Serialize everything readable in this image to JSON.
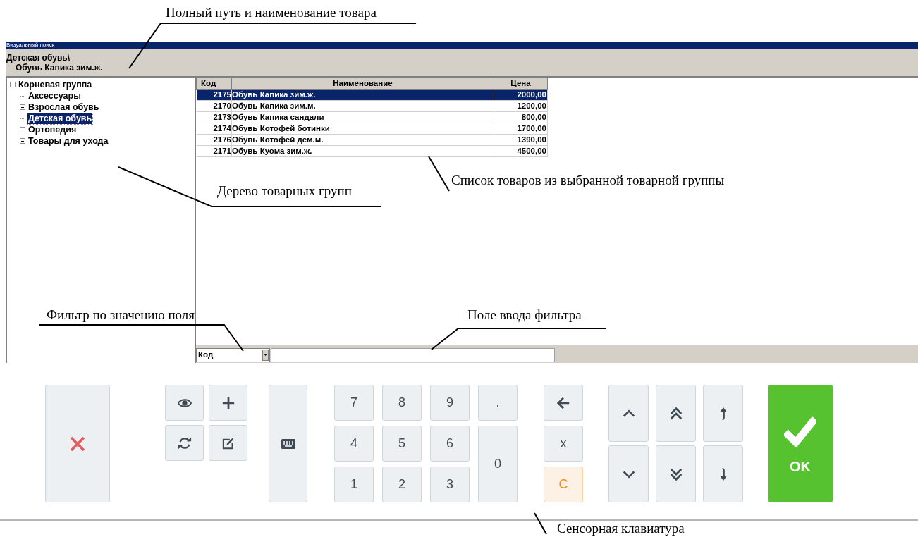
{
  "annotations": [
    {
      "text": "Полный путь и наименование товара"
    },
    {
      "text": "Дерево товарных групп"
    },
    {
      "text": "Список товаров из выбранной товарной группы"
    },
    {
      "text": "Фильтр по значению поля"
    },
    {
      "text": "Поле ввода фильтра"
    },
    {
      "text": "Сенсорная клавиатура"
    }
  ],
  "window": {
    "title": "Визуальный поиск"
  },
  "path": {
    "lines": [
      "Детская обувь\\",
      "Обувь Капика зим.ж."
    ]
  },
  "tree": [
    {
      "kind": "group",
      "label": "Корневая группа",
      "selected": false,
      "expanded": true,
      "children": [
        {
          "kind": "leaf",
          "label": "Аксессуары",
          "selected": false,
          "expanded": false
        },
        {
          "kind": "group",
          "label": "Взрослая обувь",
          "selected": false,
          "expanded": false
        },
        {
          "kind": "leaf",
          "label": "Детская обувь",
          "selected": true,
          "expanded": false
        },
        {
          "kind": "group",
          "label": "Ортопедия",
          "selected": false,
          "expanded": false
        },
        {
          "kind": "group",
          "label": "Товары для ухода",
          "selected": false,
          "expanded": false
        }
      ]
    }
  ],
  "table": {
    "columns": [
      "Код",
      "Наименование",
      "Цена"
    ],
    "rows": [
      {
        "code": "2175",
        "name": "Обувь Капика зим.ж.",
        "price": "2000,00",
        "selected": true
      },
      {
        "code": "2170",
        "name": "Обувь Капика зим.м.",
        "price": "1200,00",
        "selected": false
      },
      {
        "code": "2173",
        "name": "Обувь Капика сандали",
        "price": "800,00",
        "selected": false
      },
      {
        "code": "2174",
        "name": "Обувь Котофей ботинки",
        "price": "1700,00",
        "selected": false
      },
      {
        "code": "2176",
        "name": "Обувь Котофей дем.м.",
        "price": "1390,00",
        "selected": false
      },
      {
        "code": "2171",
        "name": "Обувь Куома зим.ж.",
        "price": "4500,00",
        "selected": false
      }
    ]
  },
  "filter": {
    "field": "Код"
  },
  "keypad": {
    "tools": [
      {
        "kind": "eye"
      },
      {
        "kind": "plus"
      },
      {
        "kind": "refresh"
      },
      {
        "kind": "edit"
      }
    ],
    "numpad": [
      "7",
      "8",
      "9",
      ".",
      "4",
      "5",
      "6",
      "0",
      "1",
      "2",
      "3"
    ],
    "edit_keys": [
      {
        "kind": "backspace"
      },
      {
        "kind": "text",
        "label": "x"
      },
      {
        "kind": "clear",
        "label": "C"
      }
    ],
    "nav": [
      {
        "kind": "up"
      },
      {
        "kind": "page-up"
      },
      {
        "kind": "first"
      },
      {
        "kind": "down"
      },
      {
        "kind": "page-down"
      },
      {
        "kind": "last"
      }
    ],
    "ok": {
      "label": "OK"
    }
  }
}
